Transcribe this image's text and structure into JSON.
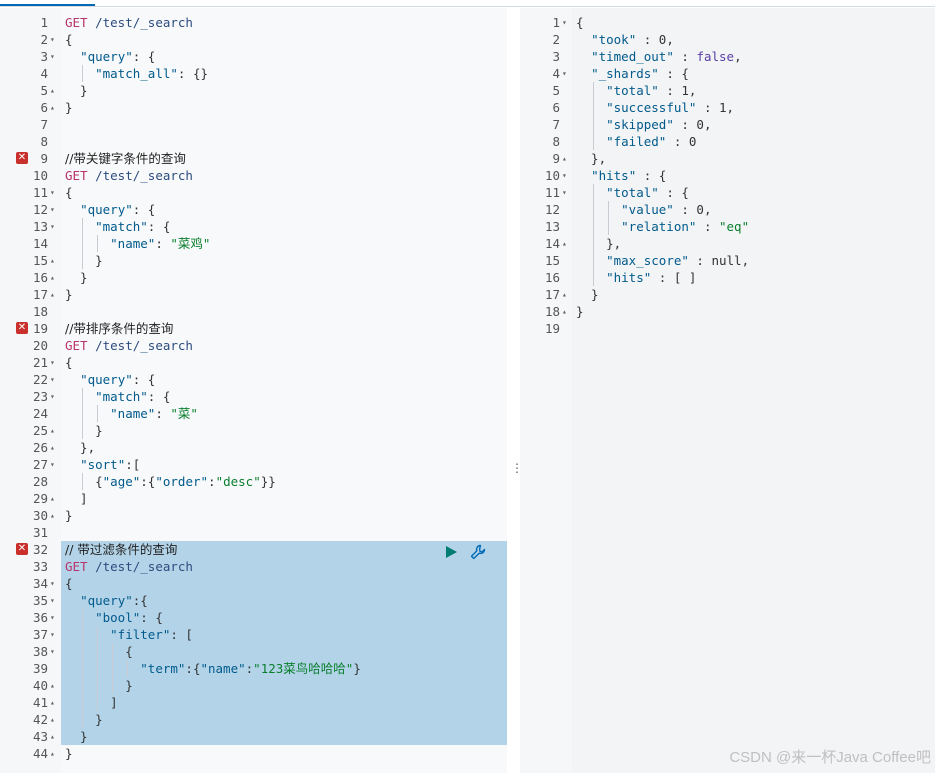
{
  "left_editor": {
    "lines": [
      {
        "n": "1",
        "fold": "",
        "tokens": [
          [
            "m",
            "GET"
          ],
          [
            "p",
            " "
          ],
          [
            "u",
            "/test/_search"
          ]
        ]
      },
      {
        "n": "2",
        "fold": "▾",
        "tokens": [
          [
            "p",
            "{"
          ]
        ]
      },
      {
        "n": "3",
        "fold": "▾",
        "tokens": [
          [
            "p",
            "  "
          ],
          [
            "k",
            "\"query\""
          ],
          [
            "p",
            ": {"
          ]
        ]
      },
      {
        "n": "4",
        "fold": "",
        "tokens": [
          [
            "p",
            "    "
          ],
          [
            "k",
            "\"match_all\""
          ],
          [
            "p",
            ": {}"
          ]
        ]
      },
      {
        "n": "5",
        "fold": "▴",
        "tokens": [
          [
            "p",
            "  }"
          ]
        ]
      },
      {
        "n": "6",
        "fold": "▴",
        "tokens": [
          [
            "p",
            "}"
          ]
        ]
      },
      {
        "n": "7",
        "fold": "",
        "tokens": []
      },
      {
        "n": "8",
        "fold": "",
        "tokens": []
      },
      {
        "n": "9",
        "fold": "",
        "err": true,
        "tokens": [
          [
            "c",
            "//带关键字条件的查询"
          ]
        ]
      },
      {
        "n": "10",
        "fold": "",
        "tokens": [
          [
            "m",
            "GET"
          ],
          [
            "p",
            " "
          ],
          [
            "u",
            "/test/_search"
          ]
        ]
      },
      {
        "n": "11",
        "fold": "▾",
        "tokens": [
          [
            "p",
            "{"
          ]
        ]
      },
      {
        "n": "12",
        "fold": "▾",
        "tokens": [
          [
            "p",
            "  "
          ],
          [
            "k",
            "\"query\""
          ],
          [
            "p",
            ": {"
          ]
        ]
      },
      {
        "n": "13",
        "fold": "▾",
        "tokens": [
          [
            "p",
            "    "
          ],
          [
            "k",
            "\"match\""
          ],
          [
            "p",
            ": {"
          ]
        ]
      },
      {
        "n": "14",
        "fold": "",
        "tokens": [
          [
            "p",
            "      "
          ],
          [
            "k",
            "\"name\""
          ],
          [
            "p",
            ": "
          ],
          [
            "s",
            "\"菜鸡\""
          ]
        ]
      },
      {
        "n": "15",
        "fold": "▴",
        "tokens": [
          [
            "p",
            "    }"
          ]
        ]
      },
      {
        "n": "16",
        "fold": "▴",
        "tokens": [
          [
            "p",
            "  }"
          ]
        ]
      },
      {
        "n": "17",
        "fold": "▴",
        "tokens": [
          [
            "p",
            "}"
          ]
        ]
      },
      {
        "n": "18",
        "fold": "",
        "tokens": []
      },
      {
        "n": "19",
        "fold": "",
        "err": true,
        "tokens": [
          [
            "c",
            "//带排序条件的查询"
          ]
        ]
      },
      {
        "n": "20",
        "fold": "",
        "tokens": [
          [
            "m",
            "GET"
          ],
          [
            "p",
            " "
          ],
          [
            "u",
            "/test/_search"
          ]
        ]
      },
      {
        "n": "21",
        "fold": "▾",
        "tokens": [
          [
            "p",
            "{"
          ]
        ]
      },
      {
        "n": "22",
        "fold": "▾",
        "tokens": [
          [
            "p",
            "  "
          ],
          [
            "k",
            "\"query\""
          ],
          [
            "p",
            ": {"
          ]
        ]
      },
      {
        "n": "23",
        "fold": "▾",
        "tokens": [
          [
            "p",
            "    "
          ],
          [
            "k",
            "\"match\""
          ],
          [
            "p",
            ": {"
          ]
        ]
      },
      {
        "n": "24",
        "fold": "",
        "tokens": [
          [
            "p",
            "      "
          ],
          [
            "k",
            "\"name\""
          ],
          [
            "p",
            ": "
          ],
          [
            "s",
            "\"菜\""
          ]
        ]
      },
      {
        "n": "25",
        "fold": "▴",
        "tokens": [
          [
            "p",
            "    }"
          ]
        ]
      },
      {
        "n": "26",
        "fold": "▴",
        "tokens": [
          [
            "p",
            "  },"
          ]
        ]
      },
      {
        "n": "27",
        "fold": "▾",
        "tokens": [
          [
            "p",
            "  "
          ],
          [
            "k",
            "\"sort\""
          ],
          [
            "p",
            ":["
          ]
        ]
      },
      {
        "n": "28",
        "fold": "",
        "tokens": [
          [
            "p",
            "    {"
          ],
          [
            "k",
            "\"age\""
          ],
          [
            "p",
            ":{"
          ],
          [
            "k",
            "\"order\""
          ],
          [
            "p",
            ":"
          ],
          [
            "s",
            "\"desc\""
          ],
          [
            "p",
            "}}"
          ]
        ]
      },
      {
        "n": "29",
        "fold": "▴",
        "tokens": [
          [
            "p",
            "  ]"
          ]
        ]
      },
      {
        "n": "30",
        "fold": "▴",
        "tokens": [
          [
            "p",
            "}"
          ]
        ]
      },
      {
        "n": "31",
        "fold": "",
        "tokens": []
      },
      {
        "n": "32",
        "fold": "",
        "err": true,
        "sel": true,
        "tokens": [
          [
            "c",
            "// 带过滤条件的查询"
          ]
        ]
      },
      {
        "n": "33",
        "fold": "",
        "sel": true,
        "tokens": [
          [
            "m",
            "GET"
          ],
          [
            "p",
            " "
          ],
          [
            "u",
            "/test/_search"
          ]
        ]
      },
      {
        "n": "34",
        "fold": "▾",
        "sel": true,
        "tokens": [
          [
            "p",
            "{"
          ]
        ]
      },
      {
        "n": "35",
        "fold": "▾",
        "sel": true,
        "tokens": [
          [
            "p",
            "  "
          ],
          [
            "k",
            "\"query\""
          ],
          [
            "p",
            ":{"
          ]
        ]
      },
      {
        "n": "36",
        "fold": "▾",
        "sel": true,
        "tokens": [
          [
            "p",
            "    "
          ],
          [
            "k",
            "\"bool\""
          ],
          [
            "p",
            ": {"
          ]
        ]
      },
      {
        "n": "37",
        "fold": "▾",
        "sel": true,
        "tokens": [
          [
            "p",
            "      "
          ],
          [
            "k",
            "\"filter\""
          ],
          [
            "p",
            ": ["
          ]
        ]
      },
      {
        "n": "38",
        "fold": "▾",
        "sel": true,
        "tokens": [
          [
            "p",
            "        {"
          ]
        ]
      },
      {
        "n": "39",
        "fold": "",
        "sel": true,
        "tokens": [
          [
            "p",
            "          "
          ],
          [
            "k",
            "\"term\""
          ],
          [
            "p",
            ":{"
          ],
          [
            "k",
            "\"name\""
          ],
          [
            "p",
            ":"
          ],
          [
            "s",
            "\"123菜鸟哈哈哈\""
          ],
          [
            "p",
            "}"
          ]
        ]
      },
      {
        "n": "40",
        "fold": "▴",
        "sel": true,
        "tokens": [
          [
            "p",
            "        }"
          ]
        ]
      },
      {
        "n": "41",
        "fold": "▴",
        "sel": true,
        "tokens": [
          [
            "p",
            "      ]"
          ]
        ]
      },
      {
        "n": "42",
        "fold": "▴",
        "sel": true,
        "tokens": [
          [
            "p",
            "    }"
          ]
        ]
      },
      {
        "n": "43",
        "fold": "▴",
        "sel": true,
        "tokens": [
          [
            "p",
            "  }"
          ]
        ]
      },
      {
        "n": "44",
        "fold": "▴",
        "tokens": [
          [
            "p",
            "}"
          ]
        ]
      }
    ]
  },
  "right_editor": {
    "lines": [
      {
        "n": "1",
        "fold": "▾",
        "tokens": [
          [
            "p",
            "{"
          ]
        ]
      },
      {
        "n": "2",
        "fold": "",
        "tokens": [
          [
            "p",
            "  "
          ],
          [
            "k",
            "\"took\""
          ],
          [
            "p",
            " : "
          ],
          [
            "n",
            "0"
          ],
          [
            "p",
            ","
          ]
        ]
      },
      {
        "n": "3",
        "fold": "",
        "tokens": [
          [
            "p",
            "  "
          ],
          [
            "k",
            "\"timed_out\""
          ],
          [
            "p",
            " : "
          ],
          [
            "b",
            "false"
          ],
          [
            "p",
            ","
          ]
        ]
      },
      {
        "n": "4",
        "fold": "▾",
        "tokens": [
          [
            "p",
            "  "
          ],
          [
            "k",
            "\"_shards\""
          ],
          [
            "p",
            " : {"
          ]
        ]
      },
      {
        "n": "5",
        "fold": "",
        "tokens": [
          [
            "p",
            "    "
          ],
          [
            "k",
            "\"total\""
          ],
          [
            "p",
            " : "
          ],
          [
            "n",
            "1"
          ],
          [
            "p",
            ","
          ]
        ]
      },
      {
        "n": "6",
        "fold": "",
        "tokens": [
          [
            "p",
            "    "
          ],
          [
            "k",
            "\"successful\""
          ],
          [
            "p",
            " : "
          ],
          [
            "n",
            "1"
          ],
          [
            "p",
            ","
          ]
        ]
      },
      {
        "n": "7",
        "fold": "",
        "tokens": [
          [
            "p",
            "    "
          ],
          [
            "k",
            "\"skipped\""
          ],
          [
            "p",
            " : "
          ],
          [
            "n",
            "0"
          ],
          [
            "p",
            ","
          ]
        ]
      },
      {
        "n": "8",
        "fold": "",
        "tokens": [
          [
            "p",
            "    "
          ],
          [
            "k",
            "\"failed\""
          ],
          [
            "p",
            " : "
          ],
          [
            "n",
            "0"
          ]
        ]
      },
      {
        "n": "9",
        "fold": "▴",
        "tokens": [
          [
            "p",
            "  },"
          ]
        ]
      },
      {
        "n": "10",
        "fold": "▾",
        "tokens": [
          [
            "p",
            "  "
          ],
          [
            "k",
            "\"hits\""
          ],
          [
            "p",
            " : {"
          ]
        ]
      },
      {
        "n": "11",
        "fold": "▾",
        "tokens": [
          [
            "p",
            "    "
          ],
          [
            "k",
            "\"total\""
          ],
          [
            "p",
            " : {"
          ]
        ]
      },
      {
        "n": "12",
        "fold": "",
        "tokens": [
          [
            "p",
            "      "
          ],
          [
            "k",
            "\"value\""
          ],
          [
            "p",
            " : "
          ],
          [
            "n",
            "0"
          ],
          [
            "p",
            ","
          ]
        ]
      },
      {
        "n": "13",
        "fold": "",
        "tokens": [
          [
            "p",
            "      "
          ],
          [
            "k",
            "\"relation\""
          ],
          [
            "p",
            " : "
          ],
          [
            "s",
            "\"eq\""
          ]
        ]
      },
      {
        "n": "14",
        "fold": "▴",
        "tokens": [
          [
            "p",
            "    },"
          ]
        ]
      },
      {
        "n": "15",
        "fold": "",
        "tokens": [
          [
            "p",
            "    "
          ],
          [
            "k",
            "\"max_score\""
          ],
          [
            "p",
            " : "
          ],
          [
            "n",
            "null"
          ],
          [
            "p",
            ","
          ]
        ]
      },
      {
        "n": "16",
        "fold": "",
        "tokens": [
          [
            "p",
            "    "
          ],
          [
            "k",
            "\"hits\""
          ],
          [
            "p",
            " : [ ]"
          ]
        ]
      },
      {
        "n": "17",
        "fold": "▴",
        "tokens": [
          [
            "p",
            "  }"
          ]
        ]
      },
      {
        "n": "18",
        "fold": "▴",
        "tokens": [
          [
            "p",
            "}"
          ]
        ]
      },
      {
        "n": "19",
        "fold": "",
        "tokens": []
      }
    ]
  },
  "toolbar": {
    "run_icon": "play-icon",
    "settings_icon": "wrench-icon"
  },
  "divider_glyph": "⋮",
  "watermark": "CSDN @来一杯Java Coffee吧"
}
